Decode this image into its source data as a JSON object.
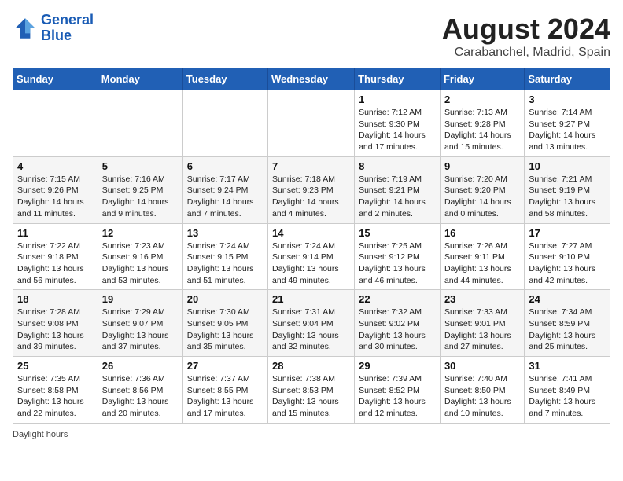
{
  "header": {
    "logo_line1": "General",
    "logo_line2": "Blue",
    "main_title": "August 2024",
    "sub_title": "Carabanchel, Madrid, Spain"
  },
  "calendar": {
    "days_of_week": [
      "Sunday",
      "Monday",
      "Tuesday",
      "Wednesday",
      "Thursday",
      "Friday",
      "Saturday"
    ],
    "weeks": [
      [
        {
          "day": "",
          "info": ""
        },
        {
          "day": "",
          "info": ""
        },
        {
          "day": "",
          "info": ""
        },
        {
          "day": "",
          "info": ""
        },
        {
          "day": "1",
          "info": "Sunrise: 7:12 AM\nSunset: 9:30 PM\nDaylight: 14 hours\nand 17 minutes."
        },
        {
          "day": "2",
          "info": "Sunrise: 7:13 AM\nSunset: 9:28 PM\nDaylight: 14 hours\nand 15 minutes."
        },
        {
          "day": "3",
          "info": "Sunrise: 7:14 AM\nSunset: 9:27 PM\nDaylight: 14 hours\nand 13 minutes."
        }
      ],
      [
        {
          "day": "4",
          "info": "Sunrise: 7:15 AM\nSunset: 9:26 PM\nDaylight: 14 hours\nand 11 minutes."
        },
        {
          "day": "5",
          "info": "Sunrise: 7:16 AM\nSunset: 9:25 PM\nDaylight: 14 hours\nand 9 minutes."
        },
        {
          "day": "6",
          "info": "Sunrise: 7:17 AM\nSunset: 9:24 PM\nDaylight: 14 hours\nand 7 minutes."
        },
        {
          "day": "7",
          "info": "Sunrise: 7:18 AM\nSunset: 9:23 PM\nDaylight: 14 hours\nand 4 minutes."
        },
        {
          "day": "8",
          "info": "Sunrise: 7:19 AM\nSunset: 9:21 PM\nDaylight: 14 hours\nand 2 minutes."
        },
        {
          "day": "9",
          "info": "Sunrise: 7:20 AM\nSunset: 9:20 PM\nDaylight: 14 hours\nand 0 minutes."
        },
        {
          "day": "10",
          "info": "Sunrise: 7:21 AM\nSunset: 9:19 PM\nDaylight: 13 hours\nand 58 minutes."
        }
      ],
      [
        {
          "day": "11",
          "info": "Sunrise: 7:22 AM\nSunset: 9:18 PM\nDaylight: 13 hours\nand 56 minutes."
        },
        {
          "day": "12",
          "info": "Sunrise: 7:23 AM\nSunset: 9:16 PM\nDaylight: 13 hours\nand 53 minutes."
        },
        {
          "day": "13",
          "info": "Sunrise: 7:24 AM\nSunset: 9:15 PM\nDaylight: 13 hours\nand 51 minutes."
        },
        {
          "day": "14",
          "info": "Sunrise: 7:24 AM\nSunset: 9:14 PM\nDaylight: 13 hours\nand 49 minutes."
        },
        {
          "day": "15",
          "info": "Sunrise: 7:25 AM\nSunset: 9:12 PM\nDaylight: 13 hours\nand 46 minutes."
        },
        {
          "day": "16",
          "info": "Sunrise: 7:26 AM\nSunset: 9:11 PM\nDaylight: 13 hours\nand 44 minutes."
        },
        {
          "day": "17",
          "info": "Sunrise: 7:27 AM\nSunset: 9:10 PM\nDaylight: 13 hours\nand 42 minutes."
        }
      ],
      [
        {
          "day": "18",
          "info": "Sunrise: 7:28 AM\nSunset: 9:08 PM\nDaylight: 13 hours\nand 39 minutes."
        },
        {
          "day": "19",
          "info": "Sunrise: 7:29 AM\nSunset: 9:07 PM\nDaylight: 13 hours\nand 37 minutes."
        },
        {
          "day": "20",
          "info": "Sunrise: 7:30 AM\nSunset: 9:05 PM\nDaylight: 13 hours\nand 35 minutes."
        },
        {
          "day": "21",
          "info": "Sunrise: 7:31 AM\nSunset: 9:04 PM\nDaylight: 13 hours\nand 32 minutes."
        },
        {
          "day": "22",
          "info": "Sunrise: 7:32 AM\nSunset: 9:02 PM\nDaylight: 13 hours\nand 30 minutes."
        },
        {
          "day": "23",
          "info": "Sunrise: 7:33 AM\nSunset: 9:01 PM\nDaylight: 13 hours\nand 27 minutes."
        },
        {
          "day": "24",
          "info": "Sunrise: 7:34 AM\nSunset: 8:59 PM\nDaylight: 13 hours\nand 25 minutes."
        }
      ],
      [
        {
          "day": "25",
          "info": "Sunrise: 7:35 AM\nSunset: 8:58 PM\nDaylight: 13 hours\nand 22 minutes."
        },
        {
          "day": "26",
          "info": "Sunrise: 7:36 AM\nSunset: 8:56 PM\nDaylight: 13 hours\nand 20 minutes."
        },
        {
          "day": "27",
          "info": "Sunrise: 7:37 AM\nSunset: 8:55 PM\nDaylight: 13 hours\nand 17 minutes."
        },
        {
          "day": "28",
          "info": "Sunrise: 7:38 AM\nSunset: 8:53 PM\nDaylight: 13 hours\nand 15 minutes."
        },
        {
          "day": "29",
          "info": "Sunrise: 7:39 AM\nSunset: 8:52 PM\nDaylight: 13 hours\nand 12 minutes."
        },
        {
          "day": "30",
          "info": "Sunrise: 7:40 AM\nSunset: 8:50 PM\nDaylight: 13 hours\nand 10 minutes."
        },
        {
          "day": "31",
          "info": "Sunrise: 7:41 AM\nSunset: 8:49 PM\nDaylight: 13 hours\nand 7 minutes."
        }
      ]
    ]
  },
  "footer": {
    "note": "Daylight hours"
  }
}
